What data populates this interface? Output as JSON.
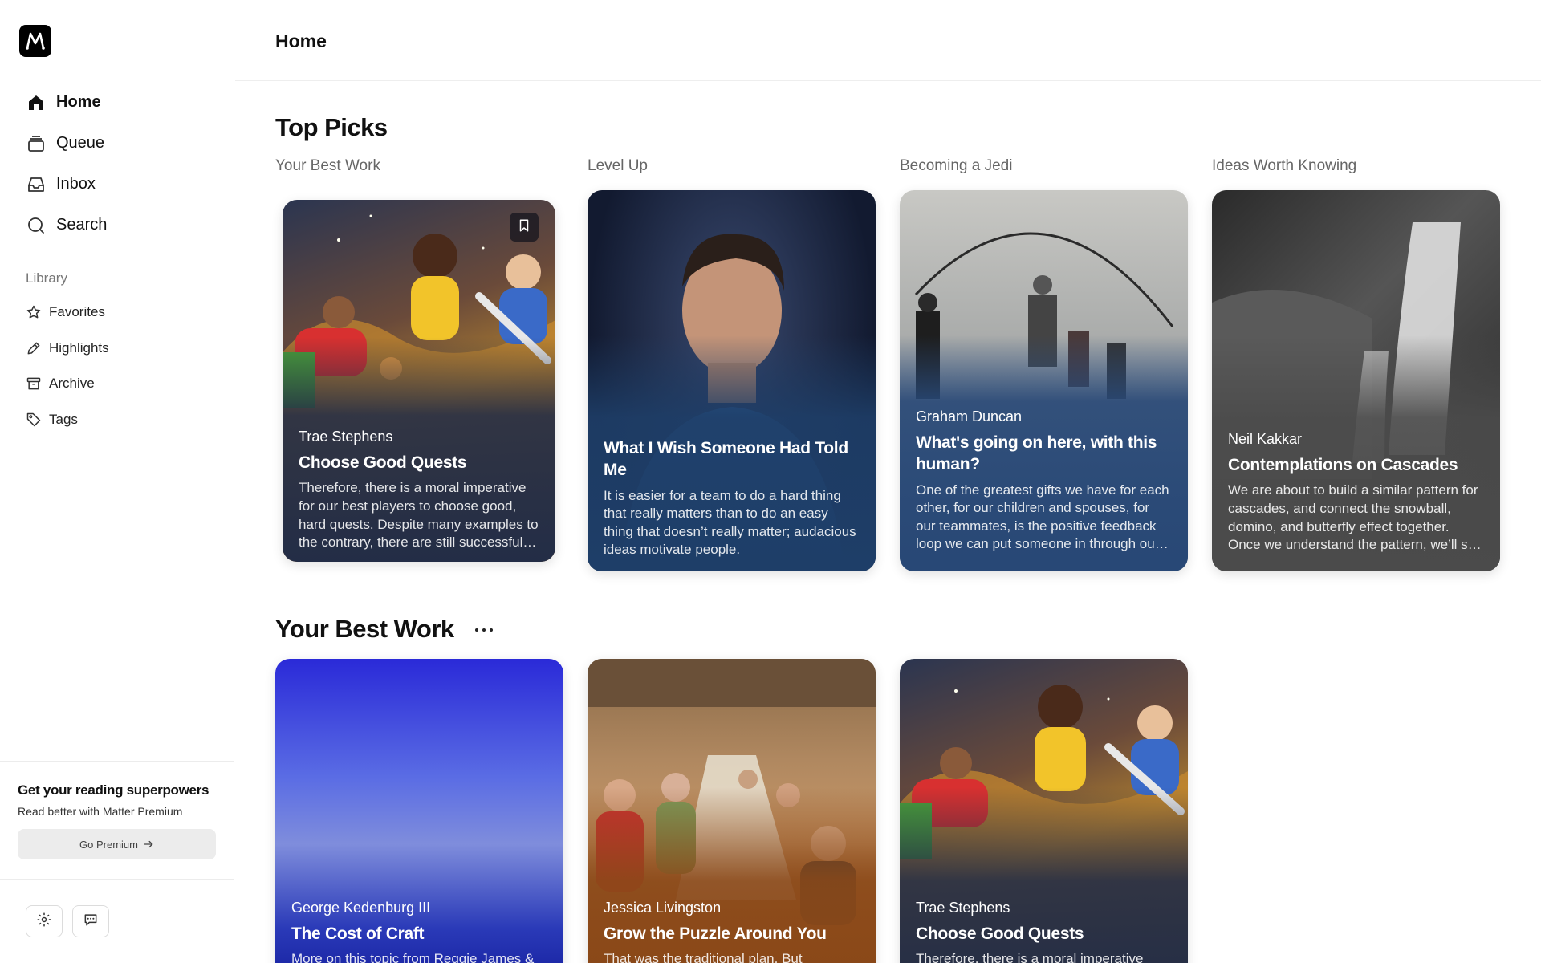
{
  "app": {
    "logo_letter": "M",
    "colors": {
      "accent": "#000000",
      "sidebar_border": "#ececec"
    }
  },
  "sidebar": {
    "nav": [
      {
        "label": "Home",
        "icon": "home-icon",
        "active": true
      },
      {
        "label": "Queue",
        "icon": "queue-icon"
      },
      {
        "label": "Inbox",
        "icon": "inbox-icon"
      },
      {
        "label": "Search",
        "icon": "search-icon"
      }
    ],
    "library_title": "Library",
    "library": [
      {
        "label": "Favorites",
        "icon": "star-icon"
      },
      {
        "label": "Highlights",
        "icon": "pencil-icon"
      },
      {
        "label": "Archive",
        "icon": "archive-icon"
      },
      {
        "label": "Tags",
        "icon": "tag-icon"
      }
    ],
    "promo": {
      "title": "Get your reading superpowers",
      "subtitle": "Read better with Matter Premium",
      "button": "Go Premium"
    },
    "footer_icons": [
      "settings-icon",
      "feedback-icon"
    ]
  },
  "header": {
    "title": "Home"
  },
  "top_picks": {
    "title": "Top Picks",
    "columns": [
      {
        "label": "Your Best Work",
        "author": "Trae Stephens",
        "title": "Choose Good Quests",
        "description": "Therefore, there is a moral imperative for our best players to choose good, hard quests. Despite many examples to the contrary, there are still successful founders who take on hard problems.",
        "bookmark_icon": "bookmark-icon"
      },
      {
        "label": "Level Up",
        "author": "",
        "title": "What I Wish Someone Had Told Me",
        "description": "It is easier for a team to do a hard thing that really matters than to do an easy thing that doesn’t really matter; audacious ideas motivate people."
      },
      {
        "label": "Becoming a Jedi",
        "author": "Graham Duncan",
        "title": "What's going on here, with this human?",
        "description": "One of the greatest gifts we have for each other, for our children and spouses, for our teammates, is the positive feedback loop we can put someone in through our attention."
      },
      {
        "label": "Ideas Worth Knowing",
        "author": "Neil Kakkar",
        "title": "Contemplations on Cascades",
        "description": "We are about to build a similar pattern for cascades, and connect the snowball, domino, and butterfly effect together. Once we understand the pattern, we’ll see it everywhere."
      }
    ]
  },
  "best_work": {
    "title": "Your Best Work",
    "more_icon": "more-horizontal-icon",
    "cards": [
      {
        "author": "George Kedenburg III",
        "title": "The Cost of Craft",
        "description": "More on this topic from Reggie James & more"
      },
      {
        "author": "Jessica Livingston",
        "title": "Grow the Puzzle Around You",
        "description": "That was the traditional plan. But"
      },
      {
        "author": "Trae Stephens",
        "title": "Choose Good Quests",
        "description": "Therefore, there is a moral imperative"
      }
    ]
  }
}
